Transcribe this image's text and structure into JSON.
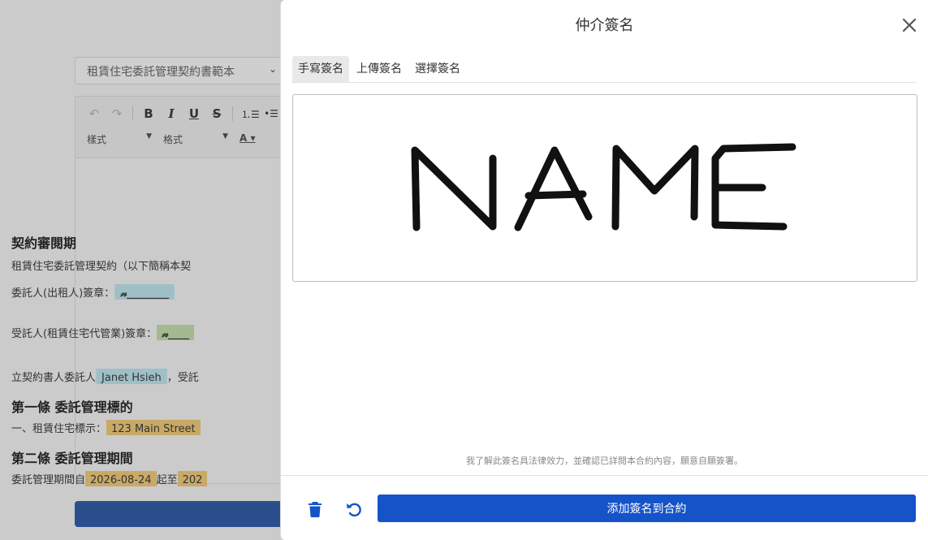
{
  "background": {
    "template_select": "租賃住宅委託管理契約書範本",
    "toolbar": {
      "style_label": "樣式",
      "format_label": "格式"
    },
    "document": {
      "heading1": "契約審閱期",
      "line1": "租賃住宅委託管理契約（以下簡稱本契",
      "line2_prefix": "委託人(出租人)簽章：",
      "line2_sig": "𝓃________",
      "line3_prefix": "受託人(租賃住宅代管業)簽章：",
      "line3_sig": "𝓃____",
      "line4_prefix": "立契約書人委託人",
      "line4_name": "Janet Hsieh",
      "line4_suffix": "，受託",
      "heading2": "第一條 委託管理標的",
      "line5_prefix": "一、租賃住宅標示：",
      "line5_value": "123 Main Street",
      "heading3": "第二條 委託管理期間",
      "line6_prefix": "委託管理期間自",
      "line6_date1": "2026-08-24",
      "line6_mid": "起至",
      "line6_date2": "202"
    }
  },
  "modal": {
    "title": "仲介簽名",
    "tabs": [
      {
        "label": "手寫簽名",
        "active": true
      },
      {
        "label": "上傳簽名",
        "active": false
      },
      {
        "label": "選擇簽名",
        "active": false
      }
    ],
    "disclaimer": "我了解此簽名具法律效力，並確認已詳閱本合約內容，願意自願簽署。",
    "submit_label": "添加簽名到合約",
    "accent_color": "#1553c9"
  }
}
